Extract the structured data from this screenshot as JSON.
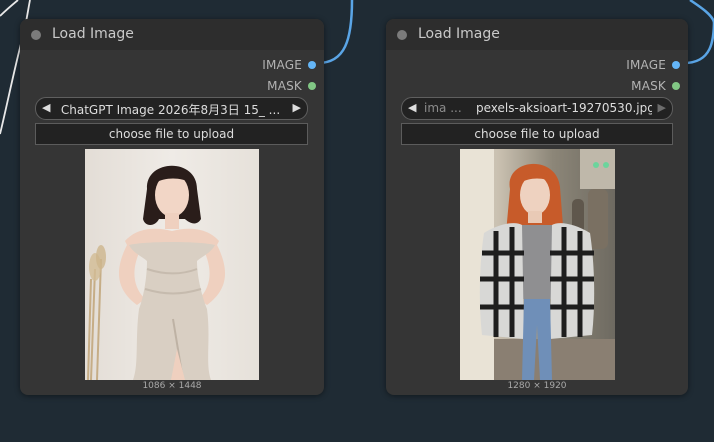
{
  "colors": {
    "canvas_bg": "#1f2b34",
    "node_bg": "#353535",
    "wire": "#5aa5e6",
    "image_slot": "#64b5f6",
    "mask_slot": "#81c784"
  },
  "nodes": [
    {
      "title": "Load Image",
      "outputs": {
        "image_label": "IMAGE",
        "mask_label": "MASK"
      },
      "image_combo": {
        "value": "ChatGPT Image 2026年8月3日 15_ ..."
      },
      "upload_label": "choose file to upload",
      "preview_icon": "portrait-photo-woman-white-dress",
      "dimensions": "1086 × 1448"
    },
    {
      "title": "Load Image",
      "outputs": {
        "image_label": "IMAGE",
        "mask_label": "MASK"
      },
      "image_combo": {
        "name": "ima ...",
        "value": "pexels-aksioart-19270530.jpg"
      },
      "upload_label": "choose file to upload",
      "preview_icon": "portrait-photo-woman-plaid-shirt",
      "dimensions": "1280 × 1920"
    }
  ]
}
